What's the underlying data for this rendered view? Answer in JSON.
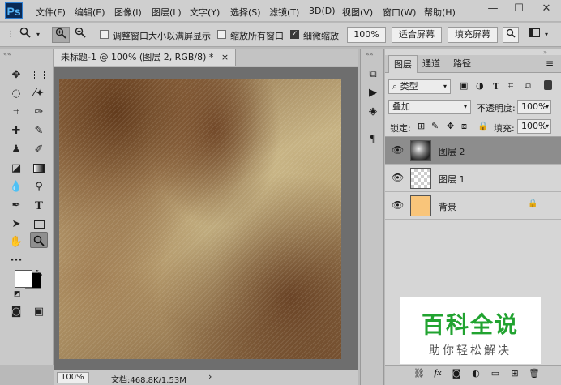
{
  "app": {
    "logo": "Ps"
  },
  "menu": [
    "文件(F)",
    "编辑(E)",
    "图像(I)",
    "图层(L)",
    "文字(Y)",
    "选择(S)",
    "滤镜(T)",
    "3D(D)",
    "视图(V)",
    "窗口(W)",
    "帮助(H)"
  ],
  "window_controls": {
    "minimize": "—",
    "maximize": "☐",
    "close": "✕"
  },
  "options": {
    "resize_windows_label": "调整窗口大小以满屏显示",
    "resize_windows_checked": false,
    "zoom_all_label": "缩放所有窗口",
    "zoom_all_checked": false,
    "scrubby_label": "细微缩放",
    "scrubby_checked": true,
    "zoom_value": "100%",
    "fit_screen": "适合屏幕",
    "fill_screen": "填充屏幕"
  },
  "document": {
    "tab_title": "未标题-1 @ 100% (图层 2, RGB/8) *",
    "zoom": "100%",
    "info": "文档:468.8K/1.53M"
  },
  "layers_panel": {
    "tabs": [
      "图层",
      "通道",
      "路径"
    ],
    "filter_kind": "类型",
    "blend_mode": "叠加",
    "opacity_label": "不透明度:",
    "opacity": "100%",
    "lock_label": "锁定:",
    "fill_label": "填充:",
    "fill": "100%",
    "layers": [
      {
        "name": "图层 2",
        "selected": true,
        "locked": false
      },
      {
        "name": "图层 1",
        "selected": false,
        "locked": false
      },
      {
        "name": "背景",
        "selected": false,
        "locked": true
      }
    ],
    "bottom_icons": [
      "link-icon",
      "fx-icon",
      "mask-icon",
      "adjustment-icon",
      "group-icon",
      "new-layer-icon",
      "trash-icon"
    ],
    "fx_text": "fx"
  },
  "watermark": {
    "title": "百科全说",
    "subtitle": "助你轻松解决"
  },
  "colors": {
    "foreground": "#ffffff",
    "background": "#000000",
    "bg_layer": "#f9c57a",
    "watermark_green": "#21a330"
  }
}
